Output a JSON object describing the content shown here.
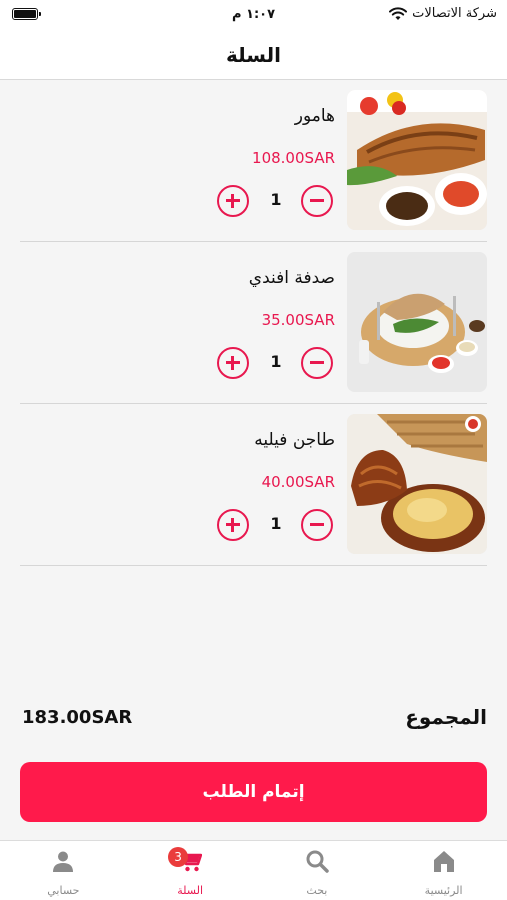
{
  "status_bar": {
    "time": "١:٠٧ م",
    "carrier": "شركة الاتصالات"
  },
  "header": {
    "title": "السلة"
  },
  "cart": {
    "items": [
      {
        "name": "هامور",
        "price": "108.00SAR",
        "quantity": "1"
      },
      {
        "name": "صدفة افندي",
        "price": "35.00SAR",
        "quantity": "1"
      },
      {
        "name": "طاجن فيليه",
        "price": "40.00SAR",
        "quantity": "1"
      }
    ]
  },
  "summary": {
    "total_label": "المجموع",
    "total_value": "183.00SAR"
  },
  "checkout": {
    "label": "إتمام الطلب"
  },
  "tab_bar": {
    "tabs": [
      {
        "label": "الرئيسية",
        "icon": "home-icon"
      },
      {
        "label": "بحث",
        "icon": "search-icon"
      },
      {
        "label": "السلة",
        "icon": "cart-icon",
        "badge": "3"
      },
      {
        "label": "حسابي",
        "icon": "user-icon"
      }
    ]
  },
  "colors": {
    "accent": "#e8184f",
    "button": "#ff1a4b",
    "badge": "#ea3c3c"
  }
}
